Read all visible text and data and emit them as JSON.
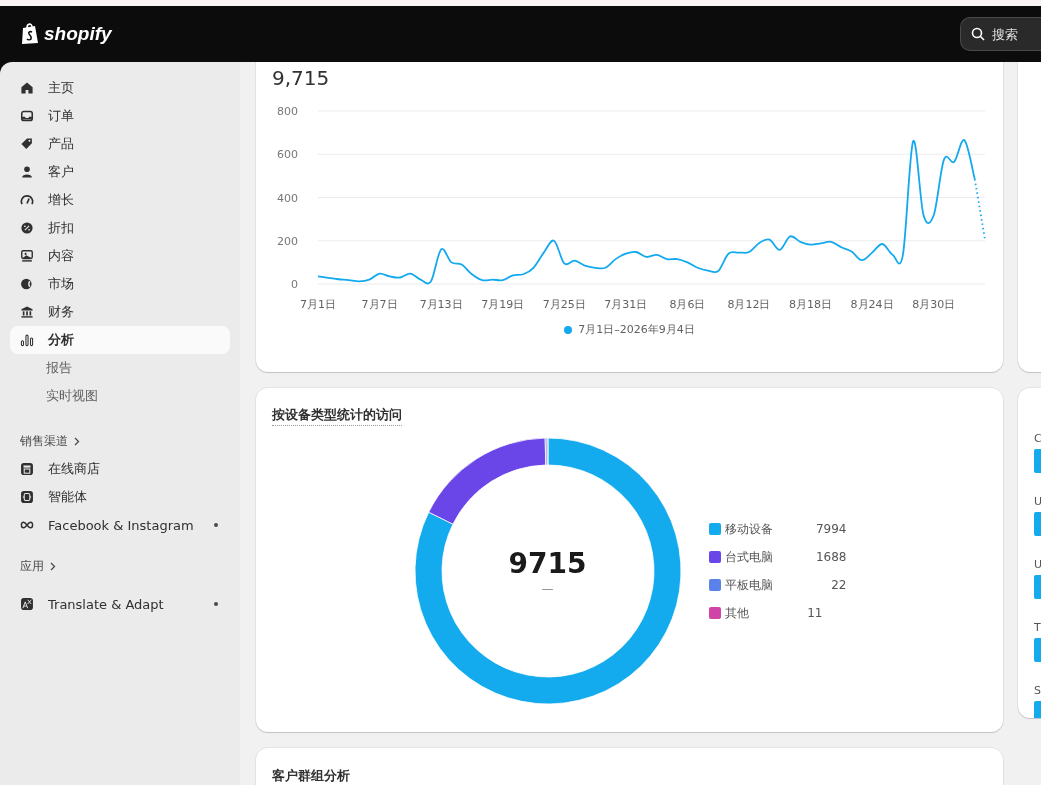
{
  "header": {
    "logo": "shopify",
    "search": {
      "placeholder": "搜索"
    }
  },
  "sidebar": {
    "items": [
      {
        "label": "主页",
        "selected": false
      },
      {
        "label": "订单",
        "selected": false
      },
      {
        "label": "产品",
        "selected": false
      },
      {
        "label": "客户",
        "selected": false
      },
      {
        "label": "增长",
        "selected": false
      },
      {
        "label": "折扣",
        "selected": false
      },
      {
        "label": "内容",
        "selected": false
      },
      {
        "label": "市场",
        "selected": false
      },
      {
        "label": "财务",
        "selected": false
      },
      {
        "label": "分析",
        "selected": true,
        "children": [
          {
            "label": "报告",
            "selected": false
          },
          {
            "label": "实时视图",
            "selected": false
          }
        ]
      }
    ],
    "sections": [
      {
        "title": "销售渠道",
        "items": [
          {
            "label": "在线商店",
            "dot": false
          },
          {
            "label": "智能体",
            "dot": false
          },
          {
            "label": "Facebook & Instagram",
            "dot": true
          }
        ]
      },
      {
        "title": "应用",
        "items": [
          {
            "label": "Translate & Adapt",
            "dot": true
          }
        ]
      }
    ]
  },
  "visits_card": {
    "total": "9,715",
    "chart_data": {
      "type": "line",
      "grid": true,
      "categories": [
        "7月1日",
        null,
        null,
        null,
        null,
        null,
        "7月7日",
        null,
        null,
        null,
        null,
        null,
        "7月13日",
        null,
        null,
        null,
        null,
        null,
        "7月19日",
        null,
        null,
        null,
        null,
        null,
        "7月25日",
        null,
        null,
        null,
        null,
        null,
        "7月31日",
        null,
        null,
        null,
        null,
        null,
        "8月6日",
        null,
        null,
        null,
        null,
        null,
        "8月12日",
        null,
        null,
        null,
        null,
        null,
        "8月18日",
        null,
        null,
        null,
        null,
        null,
        "8月24日",
        null,
        null,
        null,
        null,
        null,
        "8月30日",
        null,
        null,
        null,
        null,
        null
      ],
      "series": [
        {
          "name": "7月1日–2026年9月4日",
          "color": "#13a9ef",
          "values": [
            35,
            28,
            22,
            18,
            12,
            20,
            48,
            35,
            30,
            48,
            20,
            12,
            160,
            100,
            90,
            45,
            18,
            20,
            18,
            40,
            45,
            75,
            145,
            200,
            95,
            108,
            85,
            75,
            75,
            115,
            140,
            148,
            125,
            135,
            115,
            115,
            100,
            75,
            62,
            60,
            140,
            145,
            148,
            190,
            205,
            158,
            220,
            195,
            182,
            188,
            195,
            170,
            150,
            110,
            145,
            185,
            135,
            135,
            660,
            320,
            318,
            575,
            565,
            665,
            485,
            205
          ]
        }
      ],
      "ylim": [
        0,
        800
      ],
      "yticks": [
        0,
        200,
        400,
        600,
        800
      ]
    }
  },
  "device_card": {
    "title": "按设备类型统计的访问",
    "total": "9715",
    "change": "—",
    "chart_data": {
      "type": "donut",
      "values": [
        82.29,
        17.37,
        0.23,
        0.11
      ]
    },
    "legend": [
      {
        "label": "移动设备",
        "value": "7994",
        "color": "#13aaee"
      },
      {
        "label": "台式电脑",
        "value": "1688",
        "color": "#6a45e8"
      },
      {
        "label": "平板电脑",
        "value": "22",
        "color": "#5b82ea"
      },
      {
        "label": "其他",
        "value": "11",
        "color": "#d044a8"
      }
    ]
  },
  "side_card": {
    "rows": [
      {
        "label": "C"
      },
      {
        "label": "U"
      },
      {
        "label": "U"
      },
      {
        "label": "T"
      },
      {
        "label": "S"
      }
    ]
  },
  "cohort_card": {
    "title": "客户群组分析"
  }
}
